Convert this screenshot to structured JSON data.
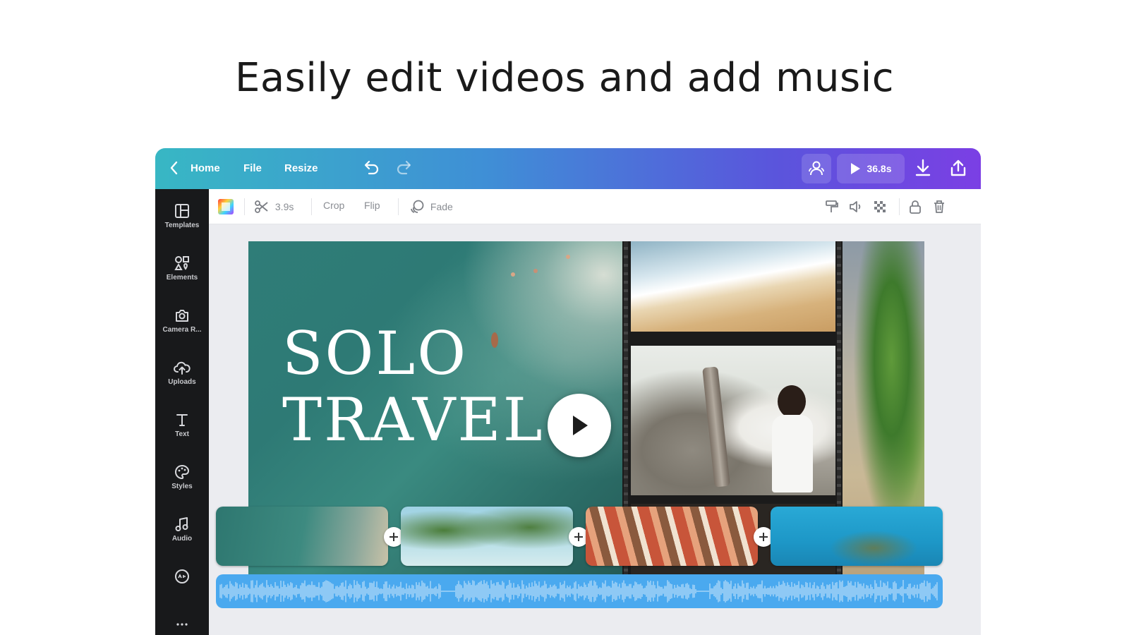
{
  "headline": "Easily edit videos and add music",
  "topbar": {
    "home_label": "Home",
    "file_label": "File",
    "resize_label": "Resize",
    "duration": "36.8s"
  },
  "sidebar": {
    "items": [
      {
        "label": "Templates",
        "icon": "templates-icon"
      },
      {
        "label": "Elements",
        "icon": "elements-icon"
      },
      {
        "label": "Camera R...",
        "icon": "camera-roll-icon"
      },
      {
        "label": "Uploads",
        "icon": "uploads-icon"
      },
      {
        "label": "Text",
        "icon": "text-icon"
      },
      {
        "label": "Styles",
        "icon": "styles-icon"
      },
      {
        "label": "Audio",
        "icon": "audio-icon"
      },
      {
        "label": "",
        "icon": "more-apps-icon"
      }
    ]
  },
  "toolbar": {
    "clip_duration": "3.9s",
    "crop_label": "Crop",
    "flip_label": "Flip",
    "fade_label": "Fade"
  },
  "design": {
    "title_line1": "SOLO",
    "title_line2": "TRAVEL"
  },
  "colors": {
    "topbar_start": "#38b7c4",
    "topbar_end": "#7b3fe4",
    "sidebar_bg": "#18191b",
    "audio_track": "#4aa9ef"
  }
}
